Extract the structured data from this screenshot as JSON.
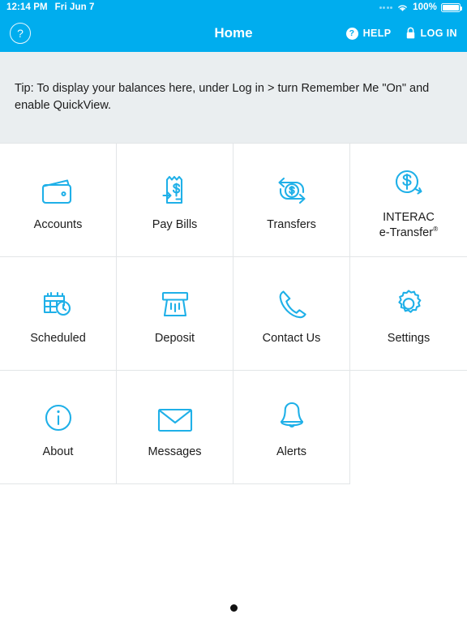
{
  "statusbar": {
    "time": "12:14 PM",
    "date": "Fri Jun 7",
    "battery_percent": "100%",
    "signal_icon": "signal-dots-icon",
    "wifi_icon": "wifi-icon",
    "battery_icon": "battery-full-icon"
  },
  "navbar": {
    "title": "Home",
    "help_circle_glyph": "?",
    "help_label": "HELP",
    "help_badge_glyph": "?",
    "login_label": "LOG IN",
    "lock_icon": "padlock-icon",
    "background_color": "#00ADEE"
  },
  "tip": {
    "text": "Tip: To display your balances here, under Log in > turn Remember Me \"On\" and enable QuickView.",
    "background_color": "#EAEEF0"
  },
  "grid": {
    "accent_color": "#1FB0E8",
    "tiles": [
      {
        "label": "Accounts",
        "icon": "wallet-icon"
      },
      {
        "label": "Pay Bills",
        "icon": "receipt-dollar-icon"
      },
      {
        "label": "Transfers",
        "icon": "transfer-arrows-dollar-icon"
      },
      {
        "label": "INTERAC",
        "label2": "e-Transfer",
        "trademark": "®",
        "icon": "circle-dollar-arrow-icon"
      },
      {
        "label": "Scheduled",
        "icon": "calendar-clock-icon"
      },
      {
        "label": "Deposit",
        "icon": "deposit-slot-icon"
      },
      {
        "label": "Contact Us",
        "icon": "phone-icon"
      },
      {
        "label": "Settings",
        "icon": "gear-icon"
      },
      {
        "label": "About",
        "icon": "info-circle-icon"
      },
      {
        "label": "Messages",
        "icon": "envelope-icon"
      },
      {
        "label": "Alerts",
        "icon": "bell-icon"
      }
    ]
  },
  "pager": {
    "total": 1,
    "active": 1
  }
}
